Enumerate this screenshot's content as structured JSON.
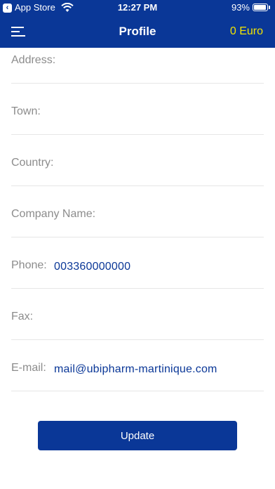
{
  "status_bar": {
    "back_app": "App Store",
    "time": "12:27 PM",
    "battery_text": "93%",
    "battery_level": 0.93
  },
  "nav": {
    "title": "Profile",
    "balance": "0 Euro",
    "menu_icon": "menu-icon"
  },
  "profile": {
    "fields": [
      {
        "label": "Address:",
        "value": ""
      },
      {
        "label": "Town:",
        "value": ""
      },
      {
        "label": "Country:",
        "value": ""
      },
      {
        "label": "Company Name:",
        "value": ""
      },
      {
        "label": "Phone:",
        "value": "003360000000"
      },
      {
        "label": "Fax:",
        "value": ""
      },
      {
        "label": "E-mail:",
        "value": "mail@ubipharm-martinique.com"
      }
    ],
    "update_label": "Update"
  },
  "colors": {
    "brand_blue": "#0a3797",
    "balance_yellow": "#f2e400",
    "label_gray": "#8c8c8c"
  }
}
